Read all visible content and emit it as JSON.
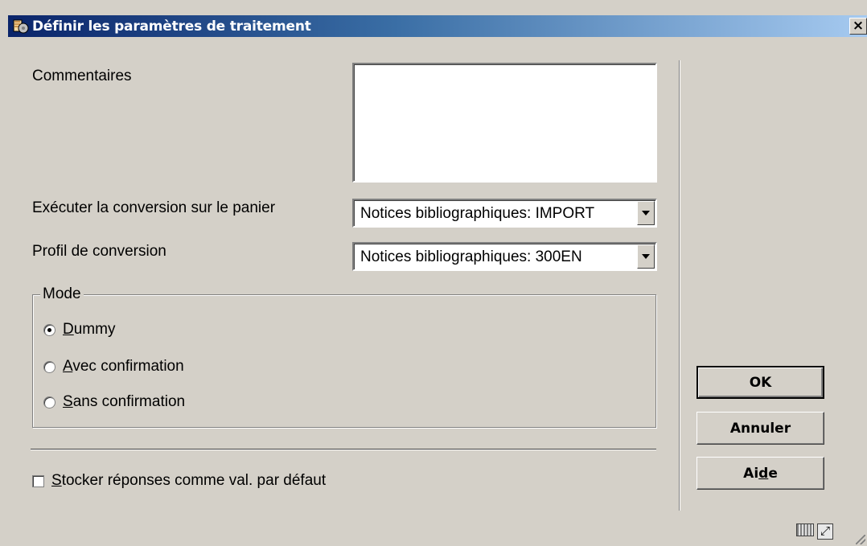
{
  "window": {
    "title": "Définir les paramètres de traitement",
    "close_label": "×"
  },
  "form": {
    "commentaires_label": "Commentaires",
    "commentaires_value": "",
    "executer_label": "Exécuter la conversion sur le panier",
    "executer_value": "Notices bibliographiques: IMPORT",
    "profil_label": "Profil de conversion",
    "profil_value": "Notices bibliographiques: 300EN"
  },
  "mode": {
    "legend": "Mode",
    "options": [
      {
        "accel": "D",
        "rest": "ummy",
        "checked": true
      },
      {
        "accel": "A",
        "rest": "vec confirmation",
        "checked": false
      },
      {
        "accel": "S",
        "rest": "ans confirmation",
        "checked": false
      }
    ]
  },
  "store_defaults": {
    "accel": "S",
    "rest": "tocker réponses comme val. par défaut",
    "checked": false
  },
  "buttons": {
    "ok": "OK",
    "cancel": "Annuler",
    "help_pre": "Ai",
    "help_accel": "d",
    "help_post": "e"
  },
  "icons": {
    "title": "app-dialog-icon",
    "keyboard": "keyboard-icon",
    "maximize": "maximize-icon",
    "resize": "resize-grip-icon"
  }
}
